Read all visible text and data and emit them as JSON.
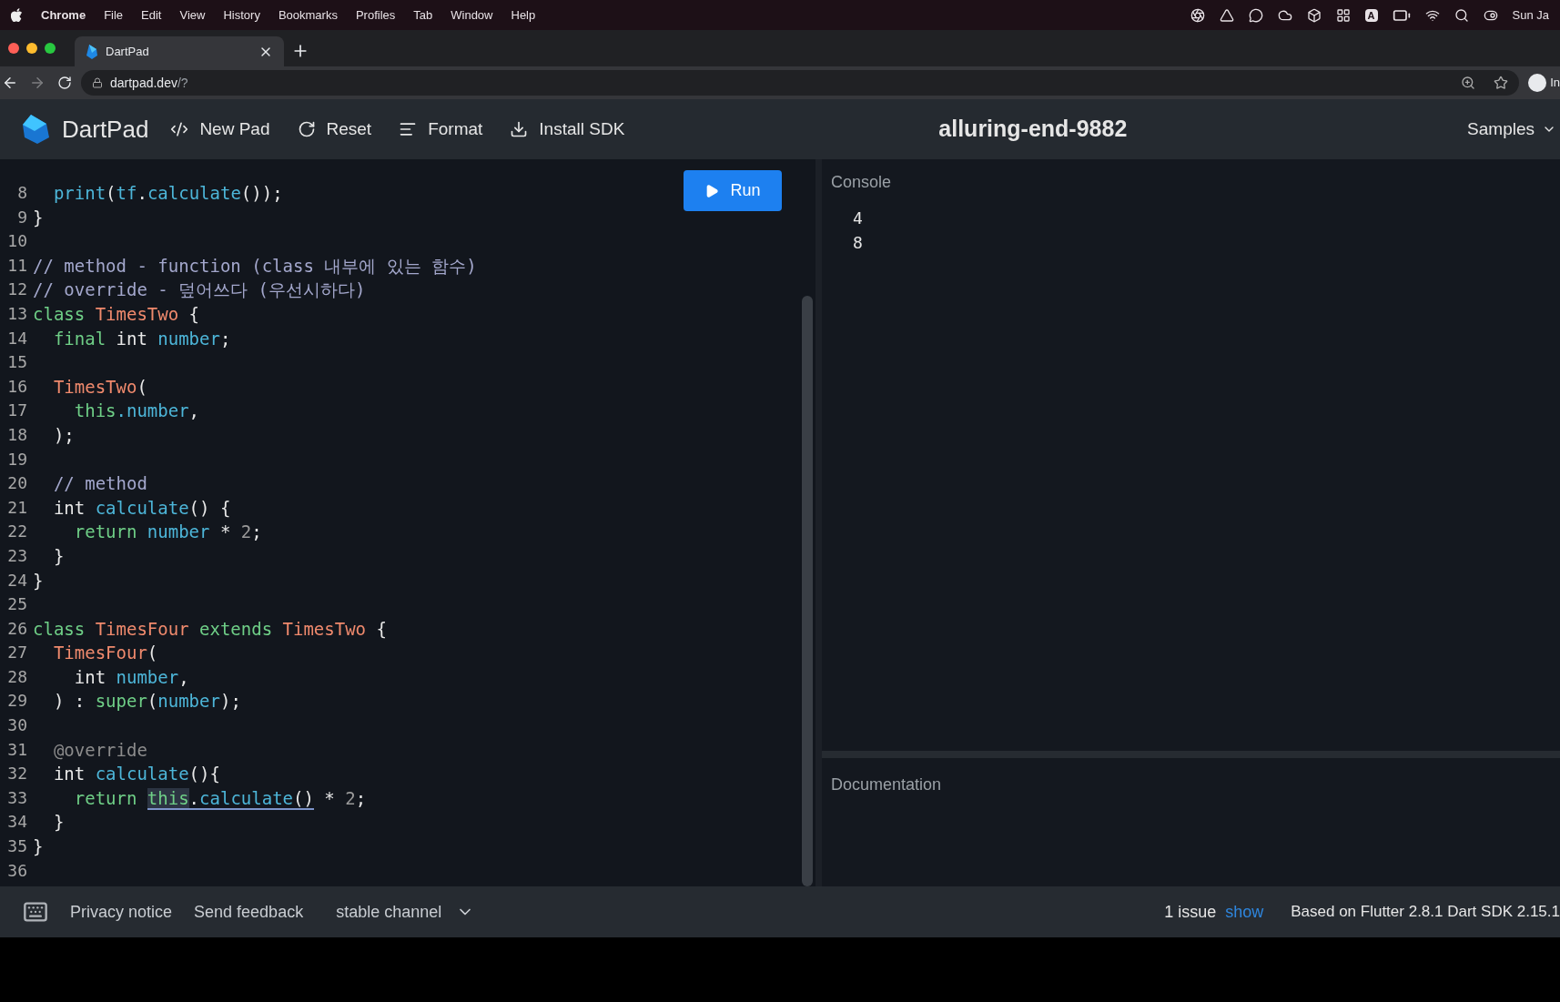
{
  "menu_bar": {
    "app": "Chrome",
    "items": [
      "File",
      "Edit",
      "View",
      "History",
      "Bookmarks",
      "Profiles",
      "Tab",
      "Window",
      "Help"
    ],
    "input_source": "A",
    "clock": "Sun Ja"
  },
  "browser": {
    "tab": {
      "title": "DartPad"
    },
    "address": {
      "host": "dartpad.dev",
      "path": "/?"
    },
    "profile_label": "In"
  },
  "header": {
    "brand": "DartPad",
    "actions": [
      {
        "kind": "code",
        "label": "New Pad"
      },
      {
        "kind": "reset",
        "label": "Reset"
      },
      {
        "kind": "format",
        "label": "Format"
      },
      {
        "kind": "download",
        "label": "Install SDK"
      }
    ],
    "title": "alluring-end-9882",
    "samples": "Samples"
  },
  "editor": {
    "run": "Run",
    "lines": [
      {
        "number": "8",
        "tokens": [
          {
            "kind": "id",
            "text": "  print"
          },
          {
            "kind": "plain",
            "text": "("
          },
          {
            "kind": "id",
            "text": "tf"
          },
          {
            "kind": "plain",
            "text": "."
          },
          {
            "kind": "id",
            "text": "calculate"
          },
          {
            "kind": "plain",
            "text": "());"
          }
        ]
      },
      {
        "number": "9",
        "tokens": [
          {
            "kind": "plain",
            "text": "}"
          }
        ]
      },
      {
        "number": "10"
      },
      {
        "number": "11",
        "tokens": [
          {
            "kind": "comment",
            "text": "// method - function (class 내부에 있는 함수)"
          }
        ]
      },
      {
        "number": "12",
        "tokens": [
          {
            "kind": "comment",
            "text": "// override - 덮어쓰다 (우선시하다)"
          }
        ]
      },
      {
        "number": "13",
        "tokens": [
          {
            "kind": "kw",
            "text": "class "
          },
          {
            "kind": "cls",
            "text": "TimesTwo"
          },
          {
            "kind": "plain",
            "text": " {"
          }
        ]
      },
      {
        "number": "14",
        "tokens": [
          {
            "kind": "kw",
            "text": "  final"
          },
          {
            "kind": "plain",
            "text": " int "
          },
          {
            "kind": "id",
            "text": "number"
          },
          {
            "kind": "plain",
            "text": ";"
          }
        ]
      },
      {
        "number": "15"
      },
      {
        "number": "16",
        "tokens": [
          {
            "kind": "cls",
            "text": "  TimesTwo"
          },
          {
            "kind": "plain",
            "text": "("
          }
        ]
      },
      {
        "number": "17",
        "tokens": [
          {
            "kind": "kw",
            "text": "    this"
          },
          {
            "kind": "id",
            "text": ".number"
          },
          {
            "kind": "plain",
            "text": ","
          }
        ]
      },
      {
        "number": "18",
        "tokens": [
          {
            "kind": "plain",
            "text": "  );"
          }
        ]
      },
      {
        "number": "19"
      },
      {
        "number": "20",
        "tokens": [
          {
            "kind": "comment",
            "text": "  // method"
          }
        ]
      },
      {
        "number": "21",
        "tokens": [
          {
            "kind": "plain",
            "text": "  int "
          },
          {
            "kind": "id",
            "text": "calculate"
          },
          {
            "kind": "plain",
            "text": "() {"
          }
        ]
      },
      {
        "number": "22",
        "tokens": [
          {
            "kind": "kw",
            "text": "    return "
          },
          {
            "kind": "id",
            "text": "number"
          },
          {
            "kind": "plain",
            "text": " * "
          },
          {
            "kind": "num",
            "text": "2"
          },
          {
            "kind": "plain",
            "text": ";"
          }
        ]
      },
      {
        "number": "23",
        "tokens": [
          {
            "kind": "plain",
            "text": "  }"
          }
        ]
      },
      {
        "number": "24",
        "tokens": [
          {
            "kind": "plain",
            "text": "}"
          }
        ]
      },
      {
        "number": "25"
      },
      {
        "number": "26",
        "tokens": [
          {
            "kind": "kw",
            "text": "class "
          },
          {
            "kind": "cls",
            "text": "TimesFour "
          },
          {
            "kind": "kw",
            "text": "extends "
          },
          {
            "kind": "cls",
            "text": "TimesTwo"
          },
          {
            "kind": "plain",
            "text": " {"
          }
        ]
      },
      {
        "number": "27",
        "tokens": [
          {
            "kind": "cls",
            "text": "  TimesFour"
          },
          {
            "kind": "plain",
            "text": "("
          }
        ]
      },
      {
        "number": "28",
        "tokens": [
          {
            "kind": "plain",
            "text": "    int "
          },
          {
            "kind": "id",
            "text": "number"
          },
          {
            "kind": "plain",
            "text": ","
          }
        ]
      },
      {
        "number": "29",
        "tokens": [
          {
            "kind": "plain",
            "text": "  ) : "
          },
          {
            "kind": "kw",
            "text": "super"
          },
          {
            "kind": "plain",
            "text": "("
          },
          {
            "kind": "id",
            "text": "number"
          },
          {
            "kind": "plain",
            "text": ");"
          }
        ]
      },
      {
        "number": "30"
      },
      {
        "number": "31",
        "tokens": [
          {
            "kind": "ann",
            "text": "  @override"
          }
        ]
      },
      {
        "number": "32",
        "tokens": [
          {
            "kind": "plain",
            "text": "  int "
          },
          {
            "kind": "id",
            "text": "calculate"
          },
          {
            "kind": "plain",
            "text": "(){"
          }
        ]
      },
      {
        "number": "33",
        "tokens": [
          {
            "kind": "kw",
            "text": "    return ",
            "underlined": false,
            "selected": false
          },
          {
            "kind": "kw",
            "text": "this",
            "underlined": true,
            "selected": true
          },
          {
            "kind": "plain",
            "text": ".",
            "underlined": true,
            "selected": false
          },
          {
            "kind": "id",
            "text": "calculate",
            "underlined": true,
            "selected": false
          },
          {
            "kind": "plain",
            "text": "()",
            "underlined": true,
            "selected": false
          },
          {
            "kind": "plain",
            "text": " * ",
            "underlined": false,
            "selected": false
          },
          {
            "kind": "num",
            "text": "2",
            "underlined": false,
            "selected": false
          },
          {
            "kind": "plain",
            "text": ";",
            "underlined": false,
            "selected": false
          }
        ]
      },
      {
        "number": "34",
        "tokens": [
          {
            "kind": "plain",
            "text": "  }"
          }
        ]
      },
      {
        "number": "35",
        "tokens": [
          {
            "kind": "plain",
            "text": "}"
          }
        ]
      },
      {
        "number": "36"
      }
    ]
  },
  "console": {
    "title": "Console",
    "output": [
      "4",
      "8"
    ]
  },
  "documentation": {
    "title": "Documentation"
  },
  "footer": {
    "links": [
      "Privacy notice",
      "Send feedback"
    ],
    "channel": "stable channel",
    "issues": "1 issue",
    "show": "show",
    "version": "Based on Flutter 2.8.1 Dart SDK 2.15.1"
  }
}
